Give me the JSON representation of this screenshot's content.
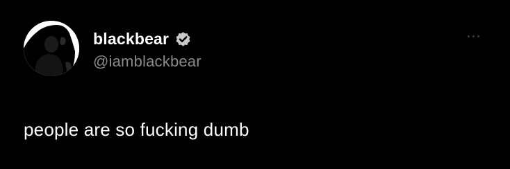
{
  "author": {
    "display_name": "blackbear",
    "handle": "@iamblackbear",
    "verified": true,
    "avatar_icon": "profile-photo"
  },
  "tweet": {
    "text": "people are so fucking dumb"
  },
  "actions": {
    "more_icon": "more-options-icon"
  },
  "colors": {
    "background": "#000000",
    "primary_text": "#ffffff",
    "secondary_text": "#8b8b8b",
    "verified_badge": "#c8c8c8"
  }
}
